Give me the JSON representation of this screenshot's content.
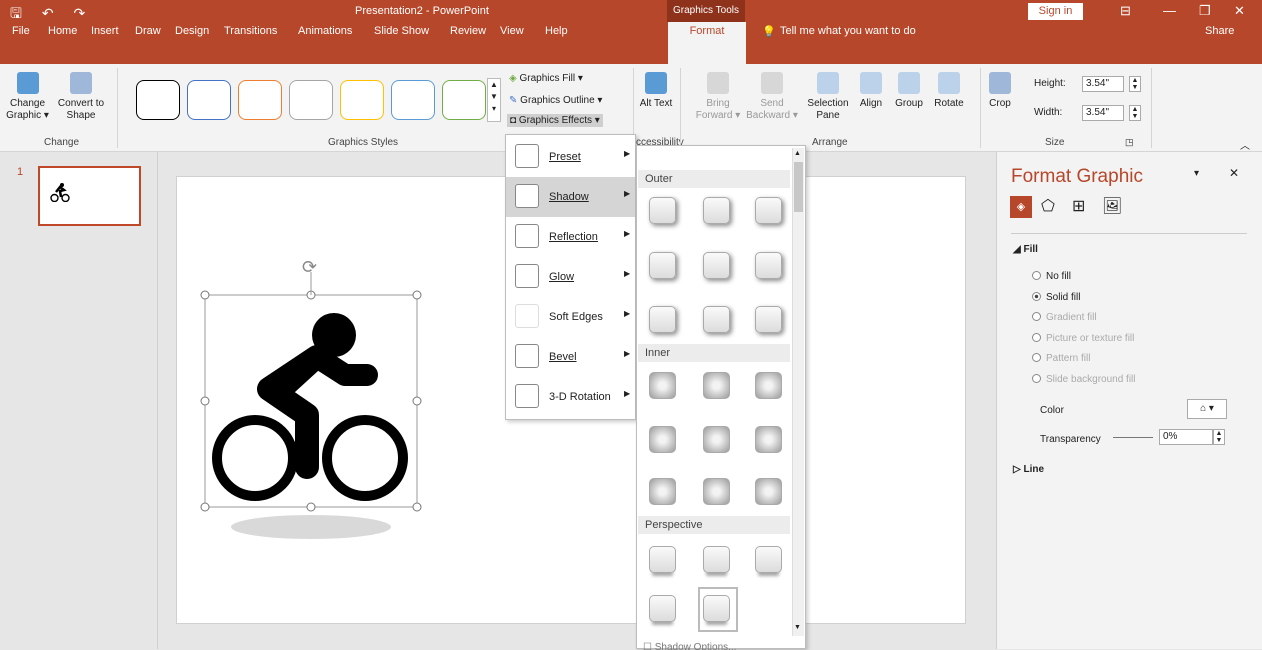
{
  "title_bar": {
    "quick_access": "🖫 ↶ ↷",
    "doc_title": "Presentation2 - PowerPoint",
    "context_tab": "Graphics Tools",
    "sign_in": "Sign in",
    "controls": [
      "⊟",
      "—",
      "❐",
      "✕"
    ]
  },
  "tabs": [
    "File",
    "Home",
    "Insert",
    "Draw",
    "Design",
    "Transitions",
    "Animations",
    "Slide Show",
    "Review",
    "View",
    "Help"
  ],
  "active_tab": "Format",
  "tell_me": "Tell me what you want to do",
  "share": "Share",
  "ribbon": {
    "change": {
      "btn1": "Change Graphic ▾",
      "btn2": "Convert to Shape",
      "label": "Change"
    },
    "styles": {
      "label": "Graphics Styles",
      "colors": [
        "#000000",
        "#4472c4",
        "#ed7d31",
        "#a5a5a5",
        "#ffc000",
        "#5b9bd5",
        "#70ad47"
      ]
    },
    "fill": "Graphics Fill ▾",
    "outline": "Graphics Outline ▾",
    "effects": "Graphics Effects ▾",
    "alt_text": "Alt Text",
    "accessibility_label": "ccessibility",
    "arrange": {
      "bring": "Bring Forward ▾",
      "send": "Send Backward ▾",
      "selection": "Selection Pane",
      "align": "Align",
      "group": "Group",
      "rotate": "Rotate",
      "label": "Arrange"
    },
    "size": {
      "crop": "Crop",
      "height_label": "Height:",
      "height": "3.54\"",
      "width_label": "Width:",
      "width": "3.54\"",
      "label": "Size"
    }
  },
  "slides": {
    "number": "1"
  },
  "effects_menu": {
    "items": [
      "Preset",
      "Shadow",
      "Reflection",
      "Glow",
      "Soft Edges",
      "Bevel",
      "3-D Rotation"
    ],
    "selected": "Shadow"
  },
  "shadow_gallery": {
    "sections": [
      "Outer",
      "Inner",
      "Perspective"
    ],
    "footer": "Shadow Options..."
  },
  "format_pane": {
    "title": "Format Graphic",
    "fill_header": "Fill",
    "options": [
      {
        "label": "No fill",
        "enabled": true,
        "checked": false
      },
      {
        "label": "Solid fill",
        "enabled": true,
        "checked": true
      },
      {
        "label": "Gradient fill",
        "enabled": false,
        "checked": false
      },
      {
        "label": "Picture or texture fill",
        "enabled": false,
        "checked": false
      },
      {
        "label": "Pattern fill",
        "enabled": false,
        "checked": false
      },
      {
        "label": "Slide background fill",
        "enabled": false,
        "checked": false
      }
    ],
    "color_label": "Color",
    "transparency_label": "Transparency",
    "transparency_value": "0%",
    "line_header": "Line"
  }
}
